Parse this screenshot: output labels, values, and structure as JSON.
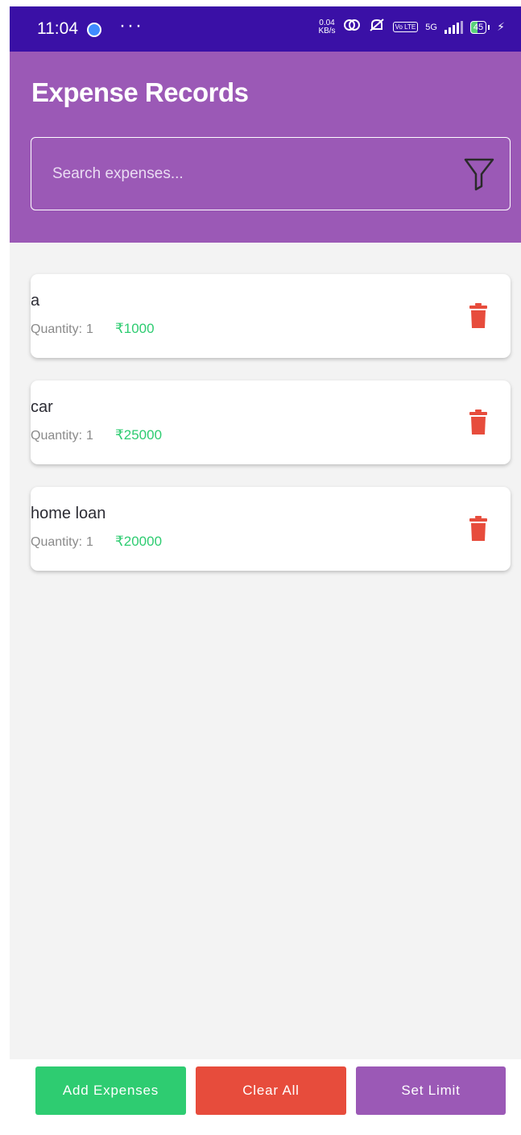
{
  "status_bar": {
    "time": "11:04",
    "more": "···",
    "net_speed_value": "0.04",
    "net_speed_unit": "KB/s",
    "volte_badge": "Vo LTE",
    "network": "5G",
    "battery_level": "45",
    "icons": [
      "call-icon",
      "hotspot-icon",
      "mute-icon",
      "volte-icon",
      "signal-icon",
      "battery-icon",
      "charging-icon"
    ]
  },
  "header": {
    "title": "Expense Records",
    "search_placeholder": "Search expenses...",
    "filter_icon": "filter-icon"
  },
  "expenses": [
    {
      "name": "a",
      "quantity_label": "Quantity:",
      "quantity": "1",
      "amount": "₹1000"
    },
    {
      "name": "car",
      "quantity_label": "Quantity:",
      "quantity": "1",
      "amount": "₹25000"
    },
    {
      "name": "home loan",
      "quantity_label": "Quantity:",
      "quantity": "1",
      "amount": "₹20000"
    }
  ],
  "actions": {
    "add_label": "Add Expenses",
    "clear_label": "Clear All",
    "limit_label": "Set Limit"
  },
  "colors": {
    "header": "#9b59b6",
    "status_bar": "#3a10a6",
    "amount": "#2ecc71",
    "delete": "#e74c3c",
    "add_button": "#2ecc71",
    "clear_button": "#e74c3c",
    "limit_button": "#9b59b6",
    "list_background": "#f3f3f3"
  }
}
